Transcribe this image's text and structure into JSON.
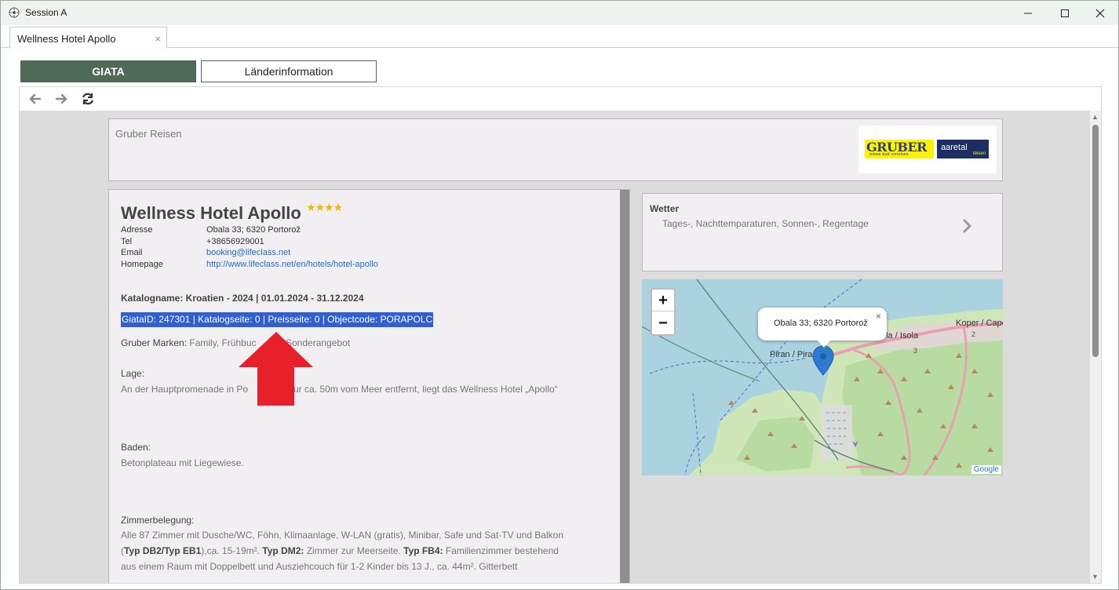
{
  "window": {
    "title": "Session A"
  },
  "tabs": [
    {
      "label": "Wellness Hotel Apollo",
      "close": "×"
    }
  ],
  "nav": {
    "giata_label": "GIATA",
    "laender_label": "Länderinformation"
  },
  "header": {
    "org": "Gruber Reisen",
    "logo_text": "GRUBER",
    "logo_tagline": "reisen statt verreisen.",
    "logo2_text": "aaretal",
    "logo2_sub": "reisen"
  },
  "hotel": {
    "name": "Wellness Hotel Apollo",
    "stars": "★★★★",
    "info": [
      {
        "key": "Adresse",
        "value": "Obala 33; 6320 Portorož"
      },
      {
        "key": "Tel",
        "value": "+38656929001"
      },
      {
        "key": "Email",
        "value": "booking@lifeclass.net"
      },
      {
        "key": "Homepage",
        "value": "http://www.lifeclass.net/en/hotels/hotel-apollo"
      }
    ],
    "catalog_label": "Katalogname: Kroatien - 2024",
    "catalog_dates": " | 01.01.2024 - 31.12.2024",
    "giata_line": "GiataID: 247301 | Katalogseite: 0 | Preisseite: 0 | Objectcode: PORAPOLC",
    "marken_label": "Gruber Marken:",
    "marken_value": " Family, Frühbuc",
    "marken_tail": "Sonderangebot",
    "lage_title": "Lage:",
    "lage_text_a": "An der Hauptpromenade in Po",
    "lage_text_b": "ur ca. 50m vom Meer entfernt, liegt das Wellness Hotel „Apollo“",
    "baden_title": "Baden:",
    "baden_text": "Betonplateau mit Liegewiese.",
    "zimmer_title": "Zimmerbelegung:",
    "zimmer_l1": "Alle 87 Zimmer mit Dusche/WC, Föhn, Klimaanlage, W-LAN (gratis), Minibar, Safe und Sat-TV und Balkon",
    "zimmer_l2a": "(",
    "zimmer_l2b": "Typ DB2/Typ EB1",
    "zimmer_l2c": "),ca. 15-19m². ",
    "zimmer_l2d": "Typ DM2:",
    "zimmer_l2e": " Zimmer zur Meerseite. ",
    "zimmer_l2f": "Typ FB4:",
    "zimmer_l2g": " Familienzimmer bestehend",
    "zimmer_l3": "aus einem Raum mit Doppelbett und Ausziehcouch für 1-2 Kinder bis 13 J., ca. 44m². Gitterbett"
  },
  "wetter": {
    "title": "Wetter",
    "subtitle": "Tages-, Nachttemparaturen, Sonnen-, Regentage"
  },
  "map": {
    "zoom_in": "+",
    "zoom_out": "−",
    "popup_text": "Obala 33; 6320 Portorož",
    "popup_close": "×",
    "label_piran": "Piran / Pira",
    "label_izola": "ola / Isola",
    "label_koper": "Koper / Capodi",
    "road_2": "2",
    "road_3": "3",
    "attribution": "Google"
  },
  "colors": {
    "accent": "#4f6a56",
    "selection": "#2f5fd0",
    "link": "#1f6fd1",
    "arrow": "#e8202a"
  }
}
